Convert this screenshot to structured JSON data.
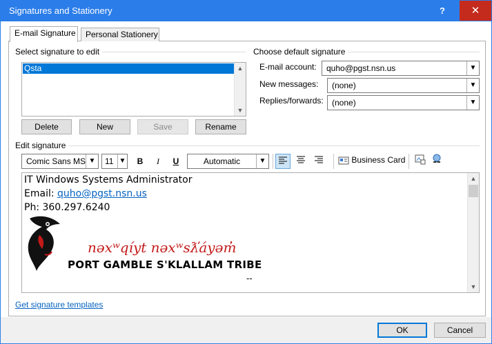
{
  "window": {
    "title": "Signatures and Stationery",
    "help_label": "?",
    "close_label": "✕"
  },
  "tabs": [
    {
      "label": "E-mail Signature"
    },
    {
      "label": "Personal Stationery"
    }
  ],
  "select_signature": {
    "heading": "Select signature to edit",
    "items": [
      "Qsta"
    ],
    "buttons": {
      "delete": "Delete",
      "new": "New",
      "save": "Save",
      "rename": "Rename"
    }
  },
  "default_signature": {
    "heading": "Choose default signature",
    "email_account_label": "E-mail account:",
    "email_account_value": "quho@pgst.nsn.us",
    "new_messages_label": "New messages:",
    "new_messages_value": "(none)",
    "replies_label": "Replies/forwards:",
    "replies_value": "(none)"
  },
  "edit_signature": {
    "heading": "Edit signature",
    "toolbar": {
      "font": "Comic Sans MS",
      "size": "11",
      "bold": "B",
      "italic": "I",
      "underline": "U",
      "color": "Automatic",
      "business_card": "Business Card"
    },
    "content": {
      "line1": "IT Windows Systems Administrator",
      "email_prefix": "Email: ",
      "email_link": "quho@pgst.nsn.us",
      "phone": "Ph: 360.297.6240",
      "logo_native": "nəxʷqíyt nəxʷsƛ̕áyəm̓",
      "logo_english": "PORT GAMBLE S'KLALLAM TRIBE",
      "trailing": "--"
    }
  },
  "footer": {
    "templates_link": "Get signature templates",
    "ok": "OK",
    "cancel": "Cancel"
  },
  "colors": {
    "accent": "#2b7de9",
    "selection": "#0078d7",
    "link": "#0563c1",
    "logo_red": "#c41a1a"
  }
}
